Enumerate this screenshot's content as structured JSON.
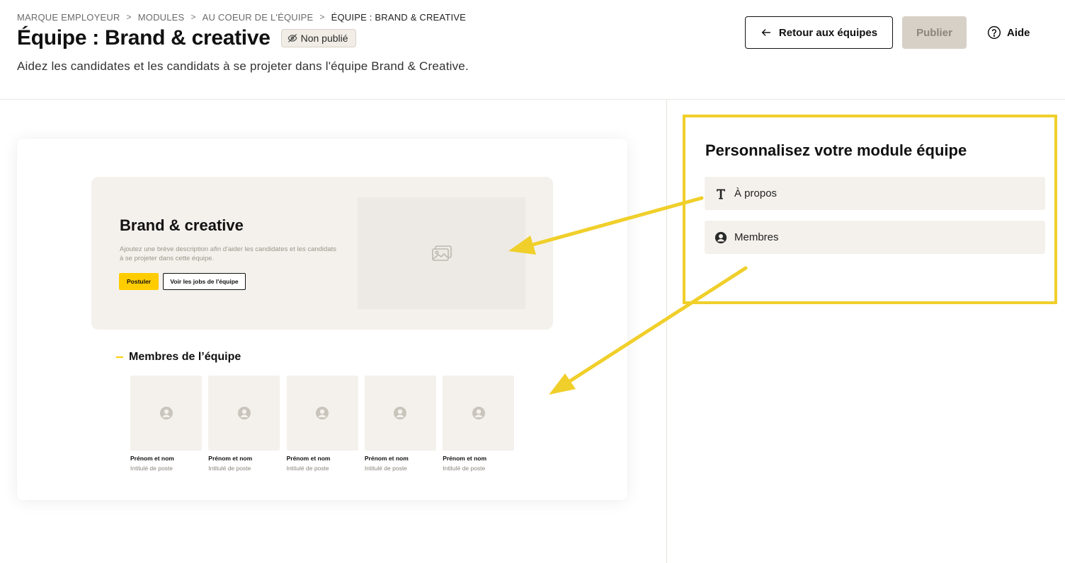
{
  "breadcrumb": {
    "items": [
      "Marque employeur",
      "Modules",
      "Au coeur de l'équipe",
      "Équipe : Brand & Creative"
    ],
    "separator": ">"
  },
  "header": {
    "title": "Équipe : Brand & creative",
    "status_badge": "Non publié",
    "subtitle": "Aidez les candidates et les candidats à se projeter dans l'équipe Brand & Creative.",
    "back_button": "Retour aux équipes",
    "publish_button": "Publier",
    "help_button": "Aide"
  },
  "preview": {
    "hero": {
      "title": "Brand & creative",
      "description": "Ajoutez une brève description afin d'aider les candidates et les candidats à se projeter dans cette équipe.",
      "apply_button": "Postuler",
      "jobs_button": "Voir les jobs de l'équipe",
      "image_icon": "image-placeholder-icon"
    },
    "members": {
      "title": "Membres de l’équipe",
      "items": [
        {
          "name": "Prénom et nom",
          "role": "Intitulé de poste"
        },
        {
          "name": "Prénom et nom",
          "role": "Intitulé de poste"
        },
        {
          "name": "Prénom et nom",
          "role": "Intitulé de poste"
        },
        {
          "name": "Prénom et nom",
          "role": "Intitulé de poste"
        },
        {
          "name": "Prénom et nom",
          "role": "Intitulé de poste"
        }
      ]
    }
  },
  "customize": {
    "title": "Personnalisez votre module équipe",
    "items": [
      {
        "label": "À propos",
        "icon": "text-icon"
      },
      {
        "label": "Membres",
        "icon": "user-icon"
      }
    ]
  },
  "colors": {
    "accent_yellow": "#ffcc00",
    "highlight_yellow": "#f0cf2a",
    "beige": "#f4f1ec",
    "publish_disabled": "#d6d0c7"
  }
}
